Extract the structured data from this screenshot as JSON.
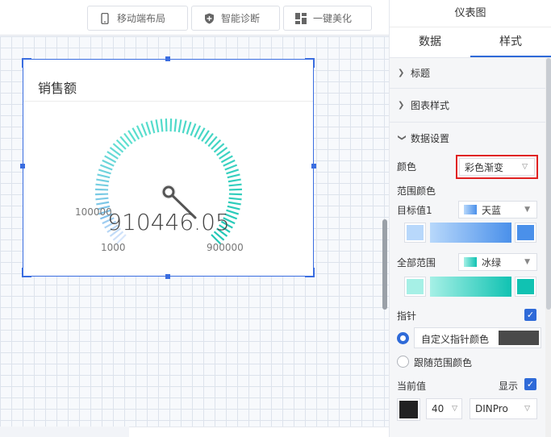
{
  "toolbar": {
    "buttons": [
      {
        "label": "移动端布局",
        "icon": "mobile-icon"
      },
      {
        "label": "智能诊断",
        "icon": "shield-plus-icon"
      },
      {
        "label": "一键美化",
        "icon": "layout-grid-icon"
      }
    ]
  },
  "widget": {
    "title": "销售额",
    "gauge": {
      "value": 910446.05,
      "value_text": "910446.05",
      "min_label": "1000",
      "max_label": "900000",
      "mid_label": "100000",
      "min": 1000,
      "max": 900000,
      "colors": [
        "#8fb8f5",
        "#5fe0d0",
        "#22c7b6"
      ]
    }
  },
  "panel": {
    "title": "仪表图",
    "tabs": [
      {
        "label": "数据",
        "active": false
      },
      {
        "label": "样式",
        "active": true
      }
    ],
    "sections": {
      "title_label": "标题",
      "chart_style_label": "图表样式",
      "data_settings_label": "数据设置"
    },
    "color": {
      "label": "颜色",
      "value": "彩色渐变",
      "highlight": "#e02020"
    },
    "range_color_label": "范围颜色",
    "target": {
      "label": "目标值1",
      "value": "天蓝",
      "swatch": "#6aa8ef",
      "start": "#b8d8fb",
      "end": "#4a90ea"
    },
    "all_range": {
      "label": "全部范围",
      "value": "冰绿",
      "swatch": "#43d7c7",
      "start": "#a6f0e6",
      "end": "#10c2b2"
    },
    "pointer": {
      "label": "指针",
      "checked": true,
      "custom_label": "自定义指针颜色",
      "custom_color": "#4a4a4a",
      "follow_label": "跟随范围颜色"
    },
    "current_value": {
      "label": "当前值",
      "show_label": "显示",
      "checked": true,
      "color": "#222222",
      "size": "40",
      "font": "DINPro"
    }
  }
}
